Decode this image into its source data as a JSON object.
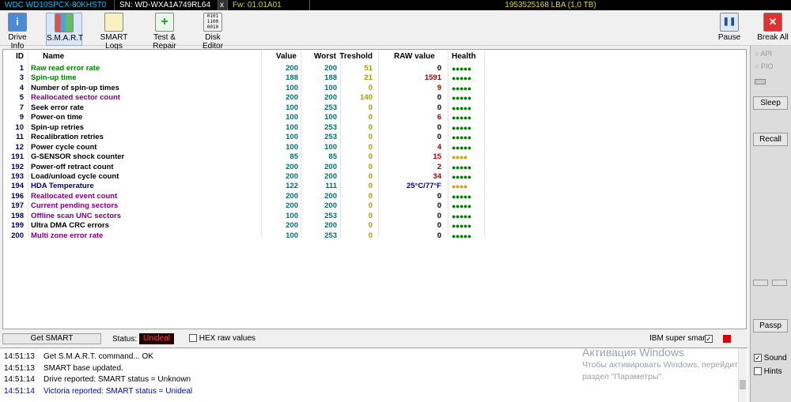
{
  "topbar": {
    "model": "WDC WD10SPCX-80KHST0",
    "serial": "SN: WD-WXA1A749RL64",
    "close": "x",
    "firmware": "Fw: 01.01A01",
    "lba": "1953525168 LBA (1,0 TB)"
  },
  "toolbar": {
    "buttons": [
      {
        "label": "Drive Info",
        "icon": "info-icon"
      },
      {
        "label": "S.M.A.R.T",
        "icon": "smart-icon"
      },
      {
        "label": "SMART Logs",
        "icon": "logs-icon"
      },
      {
        "label": "Test & Repair",
        "icon": "test-repair-icon"
      },
      {
        "label": "Disk Editor",
        "icon": "disk-editor-icon"
      }
    ],
    "pause": "Pause",
    "break_all": "Break All"
  },
  "table": {
    "headers": {
      "id": "ID",
      "name": "Name",
      "value": "Value",
      "worst": "Worst",
      "threshold": "Treshold",
      "raw": "RAW value",
      "health": "Health"
    },
    "rows": [
      {
        "id": "1",
        "name": "Raw read error rate",
        "value": "200",
        "worst": "200",
        "threshold": "51",
        "raw": "0",
        "health": "●●●●●",
        "name_color": "#008000",
        "raw_color": "#000000",
        "health_color": "#008000"
      },
      {
        "id": "3",
        "name": "Spin-up time",
        "value": "188",
        "worst": "188",
        "threshold": "21",
        "raw": "1591",
        "health": "●●●●●",
        "name_color": "#008000",
        "raw_color": "#a00000",
        "health_color": "#008000"
      },
      {
        "id": "4",
        "name": "Number of spin-up times",
        "value": "100",
        "worst": "100",
        "threshold": "0",
        "raw": "9",
        "health": "●●●●●",
        "name_color": "#000000",
        "raw_color": "#a00000",
        "health_color": "#008000"
      },
      {
        "id": "5",
        "name": "Reallocated sector count",
        "value": "200",
        "worst": "200",
        "threshold": "140",
        "raw": "0",
        "health": "●●●●●",
        "name_color": "#800080",
        "raw_color": "#000000",
        "health_color": "#008000"
      },
      {
        "id": "7",
        "name": "Seek error rate",
        "value": "100",
        "worst": "253",
        "threshold": "0",
        "raw": "0",
        "health": "●●●●●",
        "name_color": "#000000",
        "raw_color": "#000000",
        "health_color": "#008000"
      },
      {
        "id": "9",
        "name": "Power-on time",
        "value": "100",
        "worst": "100",
        "threshold": "0",
        "raw": "6",
        "health": "●●●●●",
        "name_color": "#000000",
        "raw_color": "#a00000",
        "health_color": "#008000"
      },
      {
        "id": "10",
        "name": "Spin-up retries",
        "value": "100",
        "worst": "253",
        "threshold": "0",
        "raw": "0",
        "health": "●●●●●",
        "name_color": "#000000",
        "raw_color": "#000000",
        "health_color": "#008000"
      },
      {
        "id": "11",
        "name": "Recalibration retries",
        "value": "100",
        "worst": "253",
        "threshold": "0",
        "raw": "0",
        "health": "●●●●●",
        "name_color": "#000000",
        "raw_color": "#000000",
        "health_color": "#008000"
      },
      {
        "id": "12",
        "name": "Power cycle count",
        "value": "100",
        "worst": "100",
        "threshold": "0",
        "raw": "4",
        "health": "●●●●●",
        "name_color": "#000000",
        "raw_color": "#a00000",
        "health_color": "#008000"
      },
      {
        "id": "191",
        "name": "G-SENSOR shock counter",
        "value": "85",
        "worst": "85",
        "threshold": "0",
        "raw": "15",
        "health": "●●●●",
        "name_color": "#000000",
        "raw_color": "#c00000",
        "health_color": "#d0a000"
      },
      {
        "id": "192",
        "name": "Power-off retract count",
        "value": "200",
        "worst": "200",
        "threshold": "0",
        "raw": "2",
        "health": "●●●●●",
        "name_color": "#000000",
        "raw_color": "#a00000",
        "health_color": "#008000"
      },
      {
        "id": "193",
        "name": "Load/unload cycle count",
        "value": "200",
        "worst": "200",
        "threshold": "0",
        "raw": "34",
        "health": "●●●●●",
        "name_color": "#000000",
        "raw_color": "#a00000",
        "health_color": "#008000"
      },
      {
        "id": "194",
        "name": "HDA Temperature",
        "value": "122",
        "worst": "111",
        "threshold": "0",
        "raw": "25°C/77°F",
        "health": "●●●●",
        "name_color": "#000080",
        "raw_color": "#000080",
        "health_color": "#d0a000"
      },
      {
        "id": "196",
        "name": "Reallocated event count",
        "value": "200",
        "worst": "200",
        "threshold": "0",
        "raw": "0",
        "health": "●●●●●",
        "name_color": "#800080",
        "raw_color": "#000000",
        "health_color": "#008000"
      },
      {
        "id": "197",
        "name": "Current pending sectors",
        "value": "200",
        "worst": "200",
        "threshold": "0",
        "raw": "0",
        "health": "●●●●●",
        "name_color": "#800080",
        "raw_color": "#000000",
        "health_color": "#008000"
      },
      {
        "id": "198",
        "name": "Offline scan UNC sectors",
        "value": "100",
        "worst": "253",
        "threshold": "0",
        "raw": "0",
        "health": "●●●●●",
        "name_color": "#800080",
        "raw_color": "#000000",
        "health_color": "#008000"
      },
      {
        "id": "199",
        "name": "Ultra DMA CRC errors",
        "value": "200",
        "worst": "200",
        "threshold": "0",
        "raw": "0",
        "health": "●●●●●",
        "name_color": "#000000",
        "raw_color": "#000000",
        "health_color": "#008000"
      },
      {
        "id": "200",
        "name": "Multi zone error rate",
        "value": "100",
        "worst": "253",
        "threshold": "0",
        "raw": "0",
        "health": "●●●●●",
        "name_color": "#800080",
        "raw_color": "#000000",
        "health_color": "#008000"
      }
    ]
  },
  "statusbar": {
    "get_smart": "Get SMART",
    "status_label": "Status:",
    "status_value": "Unideal",
    "hex_label": "HEX raw values",
    "ibm_label": "IBM super smart:",
    "ibm_checked": "✓"
  },
  "log": [
    {
      "time": "14:51:13",
      "text": "Get S.M.A.R.T. command... OK",
      "color": "#000000"
    },
    {
      "time": "14:51:13",
      "text": "SMART base updated.",
      "color": "#000000"
    },
    {
      "time": "14:51:14",
      "text": "Drive reported: SMART status = Unknown",
      "color": "#000000"
    },
    {
      "time": "14:51:14",
      "text": "Victoria reported: SMART status = Unideal",
      "color": "#0000c0"
    }
  ],
  "watermark": {
    "line1": "Активация Windows",
    "line2": "Чтобы активировать Windows, перейдите",
    "line3": "раздел \"Параметры\"."
  },
  "sidebar": {
    "api": "API",
    "pio": "PIO",
    "sleep": "Sleep",
    "recall": "Recall",
    "passp": "Passp",
    "sound": "Sound",
    "hints": "Hints",
    "sound_checked": "✓"
  },
  "colors": {
    "status_bg": "#200000",
    "status_fg": "#ff4040",
    "ibm_indicator": "#e00000"
  }
}
